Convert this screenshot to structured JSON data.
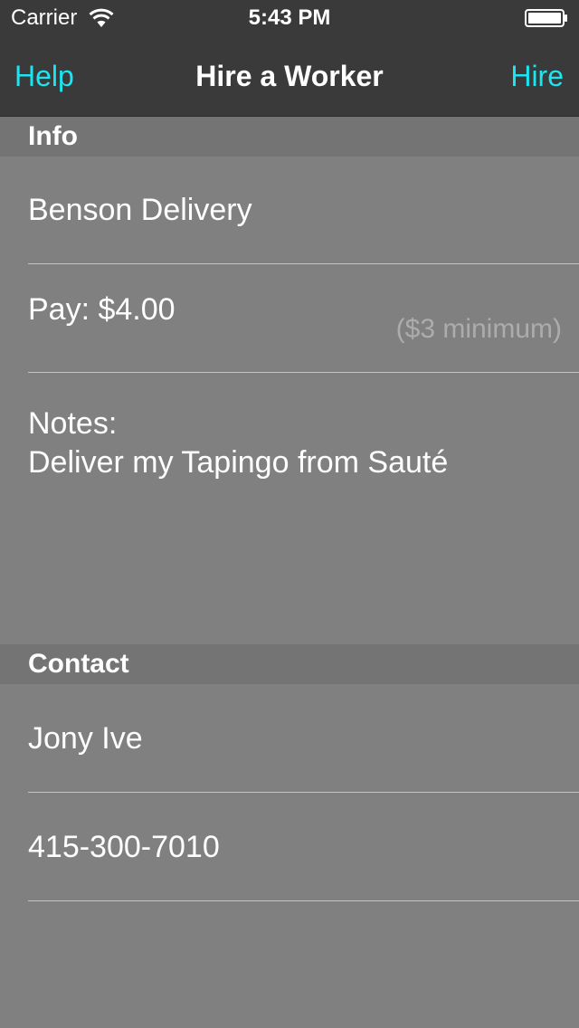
{
  "status_bar": {
    "carrier": "Carrier",
    "time": "5:43 PM",
    "wifi_icon": "wifi-icon",
    "battery_icon": "battery-icon"
  },
  "nav": {
    "left_button": "Help",
    "title": "Hire a Worker",
    "right_button": "Hire",
    "accent_color": "#19e6f2"
  },
  "sections": {
    "info": {
      "header": "Info",
      "name": "Benson Delivery",
      "pay": "Pay: $4.00",
      "pay_hint": "($3 minimum)",
      "notes_label": "Notes:",
      "notes_value": "Deliver my Tapingo from Sauté"
    },
    "contact": {
      "header": "Contact",
      "name": "Jony Ive",
      "phone": "415-300-7010"
    }
  },
  "colors": {
    "background": "#808080",
    "bar": "#3a3a3a",
    "section_header": "#747474",
    "hint_text": "#acacac"
  }
}
